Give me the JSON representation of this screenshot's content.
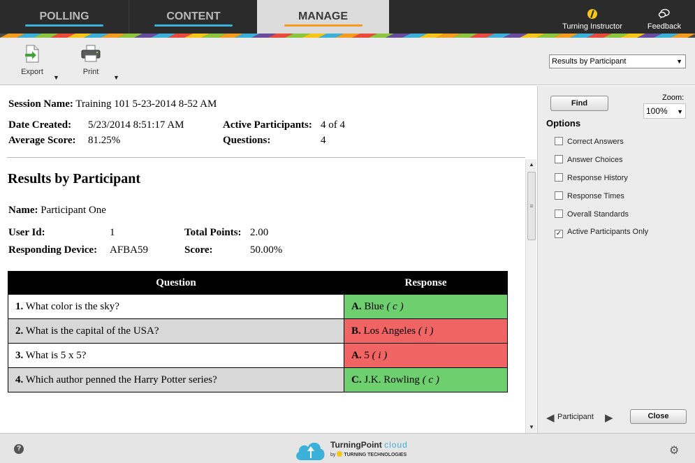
{
  "tabs": [
    {
      "label": "POLLING",
      "underline_color": "#3bb0d8"
    },
    {
      "label": "CONTENT",
      "underline_color": "#3bb0d8"
    },
    {
      "label": "MANAGE",
      "underline_color": "#f39c1f",
      "active": true
    }
  ],
  "header_tools": {
    "instructor_label": "Turning Instructor",
    "feedback_label": "Feedback"
  },
  "toolbar": {
    "export_label": "Export",
    "print_label": "Print",
    "view_select_value": "Results by Participant"
  },
  "session": {
    "name_label": "Session Name:",
    "name_value": "Training 101 5-23-2014 8-52 AM",
    "date_label": "Date Created:",
    "date_value": "5/23/2014 8:51:17 AM",
    "avg_label": "Average Score:",
    "avg_value": "81.25%",
    "active_label": "Active Participants:",
    "active_value": "4 of 4",
    "questions_label": "Questions:",
    "questions_value": "4"
  },
  "results": {
    "title": "Results by Participant",
    "name_label": "Name:",
    "name_value": "Participant One",
    "userid_label": "User Id:",
    "userid_value": "1",
    "device_label": "Responding Device:",
    "device_value": "AFBA59",
    "points_label": "Total Points:",
    "points_value": "2.00",
    "score_label": "Score:",
    "score_value": "50.00%",
    "table": {
      "headers": [
        "Question",
        "Response"
      ],
      "rows": [
        {
          "num": "1.",
          "question": "What color is the sky?",
          "letter": "A.",
          "answer": "Blue",
          "mark": "( c )",
          "status": "correct"
        },
        {
          "num": "2.",
          "question": "What is the capital of the USA?",
          "letter": "B.",
          "answer": "Los Angeles",
          "mark": "( i )",
          "status": "incorrect"
        },
        {
          "num": "3.",
          "question": "What is 5 x 5?",
          "letter": "A.",
          "answer": "5",
          "mark": "( i )",
          "status": "incorrect"
        },
        {
          "num": "4.",
          "question": "Which author penned the Harry Potter series?",
          "letter": "C.",
          "answer": "J.K. Rowling",
          "mark": "( c )",
          "status": "correct"
        }
      ]
    }
  },
  "side_panel": {
    "find_label": "Find",
    "zoom_label": "Zoom:",
    "zoom_value": "100%",
    "options_title": "Options",
    "options": [
      {
        "label": "Correct Answers",
        "checked": false
      },
      {
        "label": "Answer Choices",
        "checked": false
      },
      {
        "label": "Response History",
        "checked": false
      },
      {
        "label": "Response Times",
        "checked": false
      },
      {
        "label": "Overall Standards",
        "checked": false
      },
      {
        "label": "Active Participants Only",
        "checked": true
      }
    ],
    "nav_label": "Participant",
    "close_label": "Close"
  },
  "footer": {
    "logo_text": "TurningPoint",
    "logo_suffix": "cloud",
    "logo_by": "by",
    "logo_company": "TURNING TECHNOLOGIES"
  },
  "colors": {
    "correct": "#6ecf6e",
    "incorrect": "#f06464",
    "accent_blue": "#3bb0d8",
    "accent_orange": "#f39c1f"
  },
  "icons": [
    "export-icon",
    "printer-icon",
    "instructor-icon",
    "feedback-icon",
    "help-icon",
    "settings-icon",
    "cloud-upload-icon"
  ]
}
